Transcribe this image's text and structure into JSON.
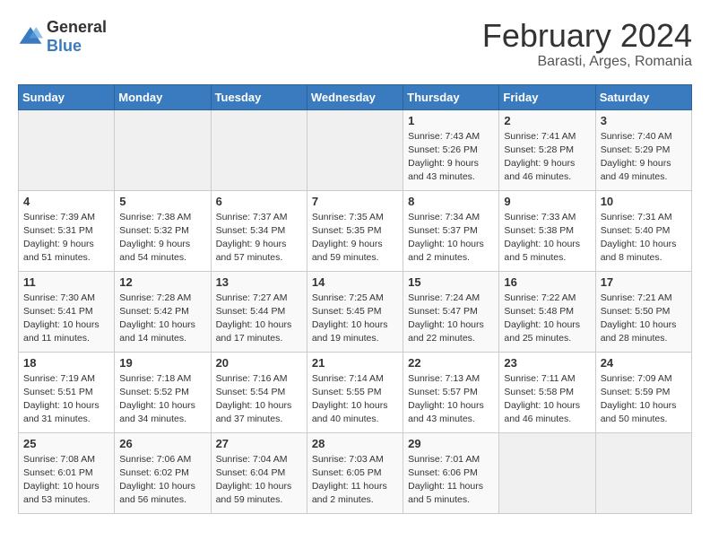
{
  "logo": {
    "general": "General",
    "blue": "Blue"
  },
  "header": {
    "month_year": "February 2024",
    "location": "Barasti, Arges, Romania"
  },
  "weekdays": [
    "Sunday",
    "Monday",
    "Tuesday",
    "Wednesday",
    "Thursday",
    "Friday",
    "Saturday"
  ],
  "weeks": [
    [
      {
        "day": "",
        "empty": true
      },
      {
        "day": "",
        "empty": true
      },
      {
        "day": "",
        "empty": true
      },
      {
        "day": "",
        "empty": true
      },
      {
        "day": "1",
        "sunrise": "7:43 AM",
        "sunset": "5:26 PM",
        "daylight": "9 hours and 43 minutes."
      },
      {
        "day": "2",
        "sunrise": "7:41 AM",
        "sunset": "5:28 PM",
        "daylight": "9 hours and 46 minutes."
      },
      {
        "day": "3",
        "sunrise": "7:40 AM",
        "sunset": "5:29 PM",
        "daylight": "9 hours and 49 minutes."
      }
    ],
    [
      {
        "day": "4",
        "sunrise": "7:39 AM",
        "sunset": "5:31 PM",
        "daylight": "9 hours and 51 minutes."
      },
      {
        "day": "5",
        "sunrise": "7:38 AM",
        "sunset": "5:32 PM",
        "daylight": "9 hours and 54 minutes."
      },
      {
        "day": "6",
        "sunrise": "7:37 AM",
        "sunset": "5:34 PM",
        "daylight": "9 hours and 57 minutes."
      },
      {
        "day": "7",
        "sunrise": "7:35 AM",
        "sunset": "5:35 PM",
        "daylight": "9 hours and 59 minutes."
      },
      {
        "day": "8",
        "sunrise": "7:34 AM",
        "sunset": "5:37 PM",
        "daylight": "10 hours and 2 minutes."
      },
      {
        "day": "9",
        "sunrise": "7:33 AM",
        "sunset": "5:38 PM",
        "daylight": "10 hours and 5 minutes."
      },
      {
        "day": "10",
        "sunrise": "7:31 AM",
        "sunset": "5:40 PM",
        "daylight": "10 hours and 8 minutes."
      }
    ],
    [
      {
        "day": "11",
        "sunrise": "7:30 AM",
        "sunset": "5:41 PM",
        "daylight": "10 hours and 11 minutes."
      },
      {
        "day": "12",
        "sunrise": "7:28 AM",
        "sunset": "5:42 PM",
        "daylight": "10 hours and 14 minutes."
      },
      {
        "day": "13",
        "sunrise": "7:27 AM",
        "sunset": "5:44 PM",
        "daylight": "10 hours and 17 minutes."
      },
      {
        "day": "14",
        "sunrise": "7:25 AM",
        "sunset": "5:45 PM",
        "daylight": "10 hours and 19 minutes."
      },
      {
        "day": "15",
        "sunrise": "7:24 AM",
        "sunset": "5:47 PM",
        "daylight": "10 hours and 22 minutes."
      },
      {
        "day": "16",
        "sunrise": "7:22 AM",
        "sunset": "5:48 PM",
        "daylight": "10 hours and 25 minutes."
      },
      {
        "day": "17",
        "sunrise": "7:21 AM",
        "sunset": "5:50 PM",
        "daylight": "10 hours and 28 minutes."
      }
    ],
    [
      {
        "day": "18",
        "sunrise": "7:19 AM",
        "sunset": "5:51 PM",
        "daylight": "10 hours and 31 minutes."
      },
      {
        "day": "19",
        "sunrise": "7:18 AM",
        "sunset": "5:52 PM",
        "daylight": "10 hours and 34 minutes."
      },
      {
        "day": "20",
        "sunrise": "7:16 AM",
        "sunset": "5:54 PM",
        "daylight": "10 hours and 37 minutes."
      },
      {
        "day": "21",
        "sunrise": "7:14 AM",
        "sunset": "5:55 PM",
        "daylight": "10 hours and 40 minutes."
      },
      {
        "day": "22",
        "sunrise": "7:13 AM",
        "sunset": "5:57 PM",
        "daylight": "10 hours and 43 minutes."
      },
      {
        "day": "23",
        "sunrise": "7:11 AM",
        "sunset": "5:58 PM",
        "daylight": "10 hours and 46 minutes."
      },
      {
        "day": "24",
        "sunrise": "7:09 AM",
        "sunset": "5:59 PM",
        "daylight": "10 hours and 50 minutes."
      }
    ],
    [
      {
        "day": "25",
        "sunrise": "7:08 AM",
        "sunset": "6:01 PM",
        "daylight": "10 hours and 53 minutes."
      },
      {
        "day": "26",
        "sunrise": "7:06 AM",
        "sunset": "6:02 PM",
        "daylight": "10 hours and 56 minutes."
      },
      {
        "day": "27",
        "sunrise": "7:04 AM",
        "sunset": "6:04 PM",
        "daylight": "10 hours and 59 minutes."
      },
      {
        "day": "28",
        "sunrise": "7:03 AM",
        "sunset": "6:05 PM",
        "daylight": "11 hours and 2 minutes."
      },
      {
        "day": "29",
        "sunrise": "7:01 AM",
        "sunset": "6:06 PM",
        "daylight": "11 hours and 5 minutes."
      },
      {
        "day": "",
        "empty": true
      },
      {
        "day": "",
        "empty": true
      }
    ]
  ],
  "labels": {
    "sunrise": "Sunrise:",
    "sunset": "Sunset:",
    "daylight": "Daylight:"
  }
}
